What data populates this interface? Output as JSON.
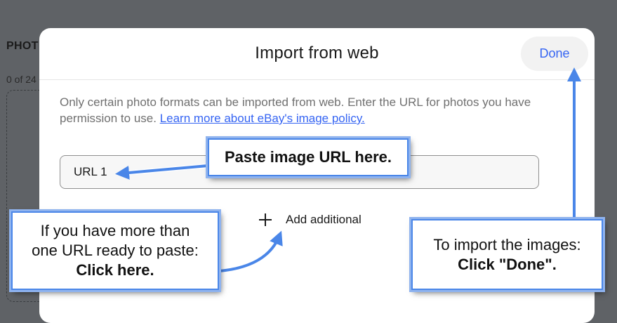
{
  "background": {
    "heading": "PHOT",
    "count": "0 of 24"
  },
  "modal": {
    "title": "Import from web",
    "done_label": "Done",
    "intro_text": "Only certain photo formats can be imported from web. Enter the URL for photos you have permission to use. ",
    "policy_link": "Learn more about eBay's image policy.",
    "url_field_value": "URL 1",
    "add_label": "Add additional"
  },
  "callouts": {
    "paste": "Paste image URL here.",
    "more_line1": "If you have more than",
    "more_line2": "one URL ready to paste:",
    "more_line3": "Click here.",
    "done_line1": "To import the images:",
    "done_line2": "Click \"Done\"."
  },
  "colors": {
    "accent": "#3665f3",
    "callout_border": "#4a86e8",
    "overlay": "#5f6266"
  }
}
